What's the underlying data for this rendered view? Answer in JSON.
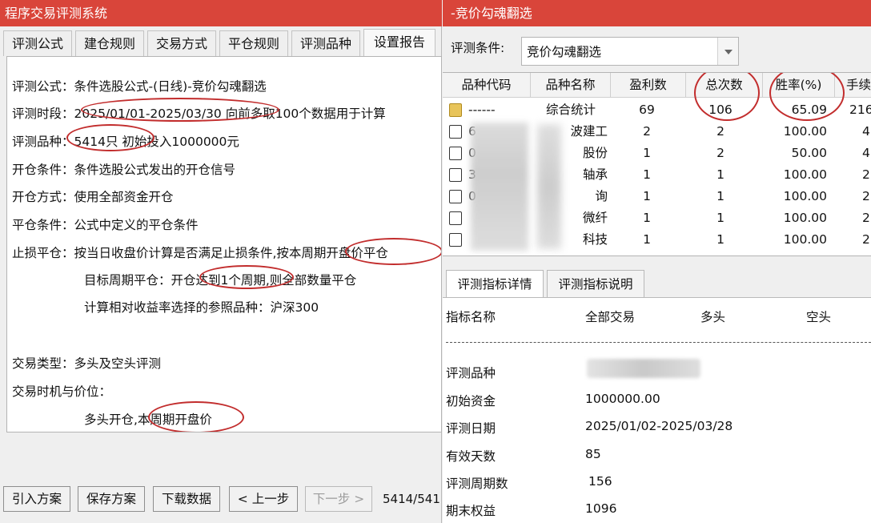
{
  "left": {
    "title": "程序交易评测系统",
    "tabs": [
      "评测公式",
      "建仓规则",
      "交易方式",
      "平仓规则",
      "评测品种",
      "设置报告"
    ],
    "lines": {
      "formula": "评测公式：条件选股公式-(日线)-竞价勾魂翻选",
      "period": "评测时段：2025/01/01-2025/03/30 向前多取100个数据用于计算",
      "symbols": "评测品种：5414只 初始投入1000000元",
      "open_cond": "开仓条件：条件选股公式发出的开仓信号",
      "open_mode": "开仓方式：使用全部资金开仓",
      "close_cond": "平仓条件：公式中定义的平仓条件",
      "stop_loss": "止损平仓：按当日收盘价计算是否满足止损条件,按本周期开盘价平仓",
      "target_close": "目标周期平仓：开仓达到1个周期,则全部数量平仓",
      "benchmark": "计算相对收益率选择的参照品种：沪深300",
      "trade_type": "交易类型：多头及空头评测",
      "timing_label": "交易时机与价位：",
      "timing_value": "多头开仓,本周期开盘价"
    },
    "buttons": {
      "import": "引入方案",
      "save": "保存方案",
      "download": "下载数据",
      "prev": "< 上一步",
      "next": "下一步 >"
    },
    "progress": "5414/541"
  },
  "right": {
    "title": "-竞价勾魂翻选",
    "condition_label": "评测条件:",
    "condition_value": "竞价勾魂翻选",
    "columns": [
      "品种代码",
      "品种名称",
      "盈利数",
      "总次数",
      "胜率(%)",
      "手续"
    ],
    "rows": [
      {
        "code": "------",
        "name": "综合统计",
        "profit": "69",
        "total": "106",
        "rate": "65.09",
        "fee": "216"
      },
      {
        "code": "6",
        "name": "波建工",
        "profit": "2",
        "total": "2",
        "rate": "100.00",
        "fee": "4"
      },
      {
        "code": "0",
        "name": "股份",
        "profit": "1",
        "total": "2",
        "rate": "50.00",
        "fee": "4"
      },
      {
        "code": "3",
        "name": "轴承",
        "profit": "1",
        "total": "1",
        "rate": "100.00",
        "fee": "2"
      },
      {
        "code": "0",
        "name": "询",
        "profit": "1",
        "total": "1",
        "rate": "100.00",
        "fee": "2"
      },
      {
        "code": "",
        "name": "微纤",
        "profit": "1",
        "total": "1",
        "rate": "100.00",
        "fee": "2"
      },
      {
        "code": "",
        "name": "科技",
        "profit": "1",
        "total": "1",
        "rate": "100.00",
        "fee": "2"
      }
    ],
    "detail_tabs": [
      "评测指标详情",
      "评测指标说明"
    ],
    "detail_header": [
      "指标名称",
      "全部交易",
      "多头",
      "空头"
    ],
    "details": [
      {
        "label": "评测品种",
        "value": ""
      },
      {
        "label": "初始资金",
        "value": "1000000.00"
      },
      {
        "label": "评测日期",
        "value": "2025/01/02-2025/03/28"
      },
      {
        "label": "有效天数",
        "value": "85"
      },
      {
        "label": "评测周期数",
        "value": "156"
      },
      {
        "label": "期末权益",
        "value": "1096"
      }
    ]
  },
  "colors": {
    "titlebar": "#d9453a",
    "annotation": "#c22d2d"
  }
}
